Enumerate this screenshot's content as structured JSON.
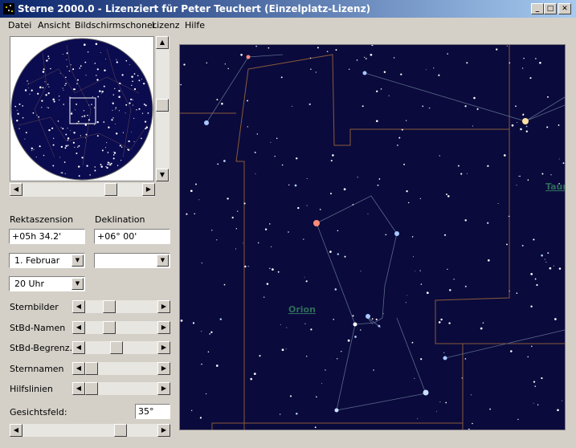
{
  "window": {
    "title": "Sterne 2000.0 - Lizenziert für Peter Teuchert (Einzelplatz-Lizenz)"
  },
  "menu": [
    "Datei",
    "Ansicht",
    "Bildschirmschoner",
    "Lizenz",
    "Hilfe"
  ],
  "coords": {
    "ra_label": "Rektaszension",
    "ra_value": "+05h 34.2'",
    "dec_label": "Deklination",
    "dec_value": "+06° 00'"
  },
  "date": {
    "selected": "1. Februar",
    "second": ""
  },
  "time": {
    "selected": "20 Uhr"
  },
  "sliders": [
    {
      "label": "Sternbilder",
      "level": 0.3
    },
    {
      "label": "StBd-Namen",
      "level": 0.3
    },
    {
      "label": "StBd-Begrenz.",
      "level": 0.42
    },
    {
      "label": "Sternnamen",
      "level": 0.0
    },
    {
      "label": "Hilfslinien",
      "level": 0.0
    }
  ],
  "fov": {
    "label": "Gesichtsfeld:",
    "value": "35°",
    "level": 0.75
  },
  "map": {
    "constellations": [
      "Orion",
      "Taur"
    ],
    "colors": {
      "sky": "#0a0a3c",
      "boundary": "#8a5a3a",
      "lines": "#5a6a8a",
      "label": "#2e6b5a"
    }
  }
}
